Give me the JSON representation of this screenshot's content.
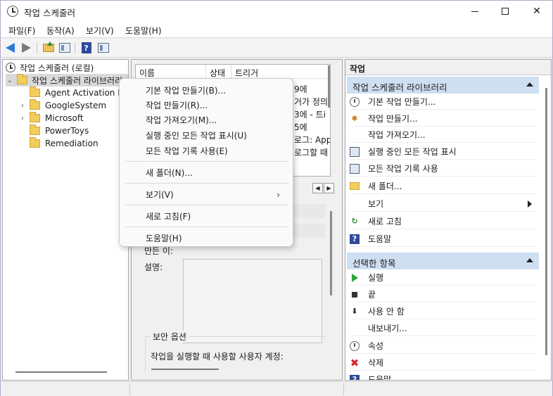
{
  "window": {
    "title": "작업 스케줄러",
    "close_glyph": "✕"
  },
  "menubar": {
    "items": [
      "파일(F)",
      "동작(A)",
      "보기(V)",
      "도움말(H)"
    ]
  },
  "toolbar": {
    "help_glyph": "?"
  },
  "tree": {
    "root_label": "작업 스케줄러 (로컬)",
    "library_label": "작업 스케줄러 라이브러리",
    "children": [
      {
        "label": "Agent Activation R",
        "expandable": false
      },
      {
        "label": "GoogleSystem",
        "expandable": true
      },
      {
        "label": "Microsoft",
        "expandable": true
      },
      {
        "label": "PowerToys",
        "expandable": false
      },
      {
        "label": "Remediation",
        "expandable": false
      }
    ],
    "expand_glyph": "›",
    "collapse_glyph": "⌄"
  },
  "task_list": {
    "columns": [
      "이름",
      "상태",
      "트리거"
    ],
    "trigger_fragments": [
      "9에",
      "거가 정의",
      "3에 - 트i",
      "5에",
      "로그: App",
      "로그할 때 -"
    ]
  },
  "detail": {
    "author_label": "만든 이:",
    "description_label": "설명:",
    "security_legend": "보안 옵션",
    "security_text": "작업을 실행할 때 사용할 사용자 계정:"
  },
  "context_menu": {
    "items": [
      "기본 작업 만들기(B)...",
      "작업 만들기(R)...",
      "작업 가져오기(M)...",
      "실행 중인 모든 작업 표시(U)",
      "모든 작업 기록 사용(E)",
      "새 폴더(N)...",
      "보기(V)",
      "새로 고침(F)",
      "도움말(H)"
    ],
    "submenu_glyph": "›"
  },
  "actions": {
    "title": "작업",
    "section1": {
      "label": "작업 스케줄러 라이브러리",
      "items": [
        {
          "label": "기본 작업 만들기...",
          "icon": "basic-task-icon"
        },
        {
          "label": "작업 만들기...",
          "icon": "create-task-icon"
        },
        {
          "label": "작업 가져오기...",
          "icon": ""
        },
        {
          "label": "실행 중인 모든 작업 표시",
          "icon": "running-tasks-icon"
        },
        {
          "label": "모든 작업 기록 사용",
          "icon": "history-icon"
        },
        {
          "label": "새 폴더...",
          "icon": "new-folder-icon"
        },
        {
          "label": "보기",
          "icon": ""
        },
        {
          "label": "새로 고침",
          "icon": "refresh-icon"
        },
        {
          "label": "도움말",
          "icon": "help-icon"
        }
      ]
    },
    "section2": {
      "label": "선택한 항목",
      "items": [
        {
          "label": "실행",
          "icon": "run-icon"
        },
        {
          "label": "끝",
          "icon": "end-icon"
        },
        {
          "label": "사용 안 함",
          "icon": "disable-icon"
        },
        {
          "label": "내보내기...",
          "icon": ""
        },
        {
          "label": "속성",
          "icon": "properties-icon"
        },
        {
          "label": "삭제",
          "icon": "delete-icon"
        },
        {
          "label": "도움말",
          "icon": "help-icon"
        }
      ]
    },
    "refresh_glyph": "↻",
    "help_glyph": "?",
    "disable_glyph": "⬇",
    "delete_glyph": "✖",
    "gear_glyph": "✱"
  },
  "colors": {
    "section_header": "#cfdff2",
    "accent_blue": "#2b7bd6",
    "delete_red": "#d32a2a",
    "run_green": "#2fa43c"
  }
}
